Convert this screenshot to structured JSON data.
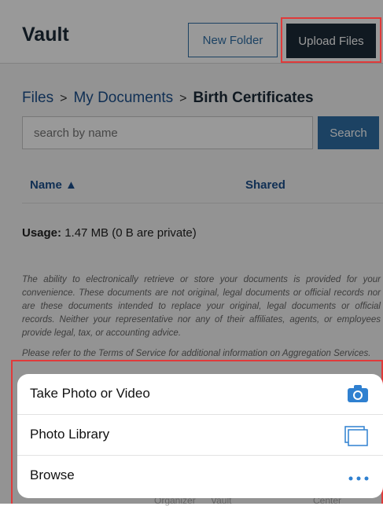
{
  "header": {
    "title": "Vault",
    "new_folder_label": "New Folder",
    "upload_files_label": "Upload Files"
  },
  "breadcrumb": {
    "items": [
      "Files",
      "My Documents"
    ],
    "separator": ">",
    "current": "Birth Certificates"
  },
  "search": {
    "placeholder": "search by name",
    "button_label": "Search"
  },
  "table": {
    "columns": [
      "Name ▲",
      "Shared"
    ]
  },
  "usage": {
    "label": "Usage:",
    "value": "1.47 MB (0 B are private)"
  },
  "disclaimer": {
    "text": "The ability to electronically retrieve or store your documents is provided for your convenience. These documents are not original, legal documents or official records nor are these documents intended to replace your original, legal documents or official records. Neither your representative nor any of their affiliates, agents, or employees provide legal, tax, or accounting advice.",
    "terms_text": "Please refer to the Terms of Service for additional information on Aggregation Services."
  },
  "footer": {
    "items": [
      "Organizer",
      "Vault",
      "Center"
    ]
  },
  "action_sheet": {
    "items": [
      {
        "label": "Take Photo or Video",
        "icon": "camera-icon"
      },
      {
        "label": "Photo Library",
        "icon": "photo-library-icon"
      },
      {
        "label": "Browse",
        "icon": "more-dots-icon"
      }
    ]
  },
  "colors": {
    "brand_dark": "#1b2a38",
    "accent_blue": "#2f6fa6",
    "ios_blue": "#2f80d0",
    "highlight_red": "#e03a3a"
  }
}
